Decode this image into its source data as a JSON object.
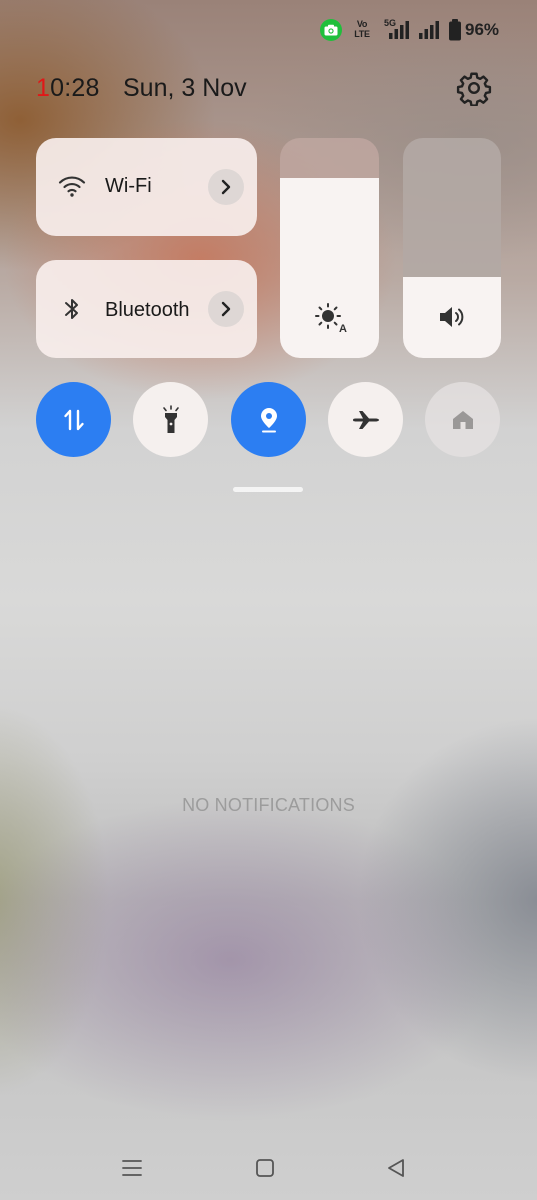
{
  "status_bar": {
    "battery_percent": "96%",
    "volte_line1": "Vo",
    "volte_line2": "LTE",
    "network_5g": "5G",
    "icons": [
      "camera-icon",
      "volte-icon",
      "signal-5g-icon",
      "signal-icon",
      "battery-icon"
    ]
  },
  "header": {
    "time_first": "1",
    "time_rest": "0:28",
    "date": "Sun, 3 Nov",
    "settings_icon": "gear-icon"
  },
  "tiles": {
    "wifi": {
      "label": "Wi-Fi",
      "icon": "wifi-icon"
    },
    "bluetooth": {
      "label": "Bluetooth",
      "icon": "bluetooth-icon"
    }
  },
  "sliders": {
    "brightness": {
      "icon": "auto-brightness-icon",
      "level": 0.82
    },
    "volume": {
      "icon": "speaker-icon",
      "level": 0.37
    }
  },
  "toggles": [
    {
      "name": "mobile-data",
      "icon": "data-transfer-icon",
      "state": "on"
    },
    {
      "name": "flashlight",
      "icon": "flashlight-icon",
      "state": "off"
    },
    {
      "name": "location",
      "icon": "location-pin-icon",
      "state": "on"
    },
    {
      "name": "airplane-mode",
      "icon": "airplane-icon",
      "state": "off"
    },
    {
      "name": "home",
      "icon": "home-icon",
      "state": "disabled"
    }
  ],
  "notifications": {
    "empty_text": "NO NOTIFICATIONS"
  },
  "nav_bar": {
    "icons": [
      "menu-icon",
      "home-square-icon",
      "back-triangle-icon"
    ]
  },
  "colors": {
    "accent": "#2c7ef2",
    "clock_highlight": "#e01818",
    "camera_badge": "#1fbf3b"
  }
}
